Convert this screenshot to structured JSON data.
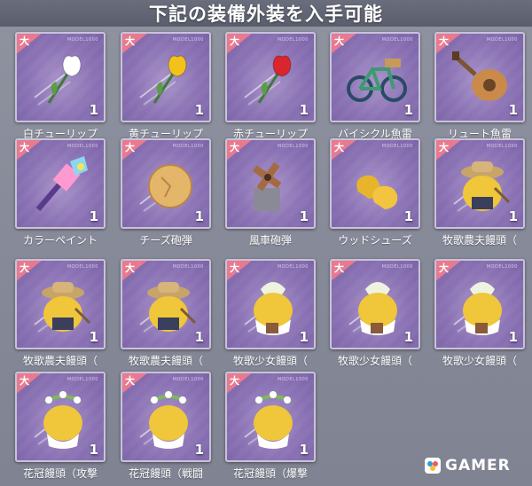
{
  "header": {
    "title": "下記の装備外装を入手可能"
  },
  "card_common": {
    "badge_glyph": "大",
    "model_tag": "MODEL1000"
  },
  "items": [
    {
      "label": "白チューリップ",
      "qty": "1",
      "icon": "white-tulip-icon",
      "color": "#ffffff"
    },
    {
      "label": "黄チューリップ",
      "qty": "1",
      "icon": "yellow-tulip-icon",
      "color": "#f2c21a"
    },
    {
      "label": "赤チューリップ",
      "qty": "1",
      "icon": "red-tulip-icon",
      "color": "#d8262c"
    },
    {
      "label": "バイシクル魚雷",
      "qty": "1",
      "icon": "bicycle-icon",
      "color": "#3d9a72"
    },
    {
      "label": "リュート魚雷",
      "qty": "1",
      "icon": "lute-icon",
      "color": "#c98a4a"
    },
    {
      "label": "カラーペイント",
      "qty": "1",
      "icon": "paintbrush-icon",
      "color": "#9fd0e8"
    },
    {
      "label": "チーズ砲弾",
      "qty": "1",
      "icon": "cheese-icon",
      "color": "#e3b66a"
    },
    {
      "label": "風車砲弾",
      "qty": "1",
      "icon": "windmill-icon",
      "color": "#a66a40"
    },
    {
      "label": "ウッドシューズ",
      "qty": "1",
      "icon": "wooden-shoes-icon",
      "color": "#e8b42c"
    },
    {
      "label": "牧歌農夫饅頭（",
      "qty": "1",
      "icon": "farmer-manjuu-icon",
      "color": "#f0c63a"
    },
    {
      "label": "牧歌農夫饅頭（",
      "qty": "1",
      "icon": "farmer-manjuu-icon",
      "color": "#f0c63a"
    },
    {
      "label": "牧歌農夫饅頭（",
      "qty": "1",
      "icon": "farmer-manjuu-icon",
      "color": "#f0c63a"
    },
    {
      "label": "牧歌少女饅頭（",
      "qty": "1",
      "icon": "maiden-manjuu-icon",
      "color": "#f0c63a"
    },
    {
      "label": "牧歌少女饅頭（",
      "qty": "1",
      "icon": "maiden-manjuu-icon",
      "color": "#f0c63a"
    },
    {
      "label": "牧歌少女饅頭（",
      "qty": "1",
      "icon": "maiden-manjuu-icon",
      "color": "#f0c63a"
    },
    {
      "label": "花冠饅頭（攻撃",
      "qty": "1",
      "icon": "flower-crown-manjuu-icon",
      "color": "#f0c63a"
    },
    {
      "label": "花冠饅頭（戦闘",
      "qty": "1",
      "icon": "flower-crown-manjuu-icon",
      "color": "#f0c63a"
    },
    {
      "label": "花冠饅頭（爆撃",
      "qty": "1",
      "icon": "flower-crown-manjuu-icon",
      "color": "#f0c63a"
    }
  ],
  "watermark": {
    "text": "GAMER"
  }
}
